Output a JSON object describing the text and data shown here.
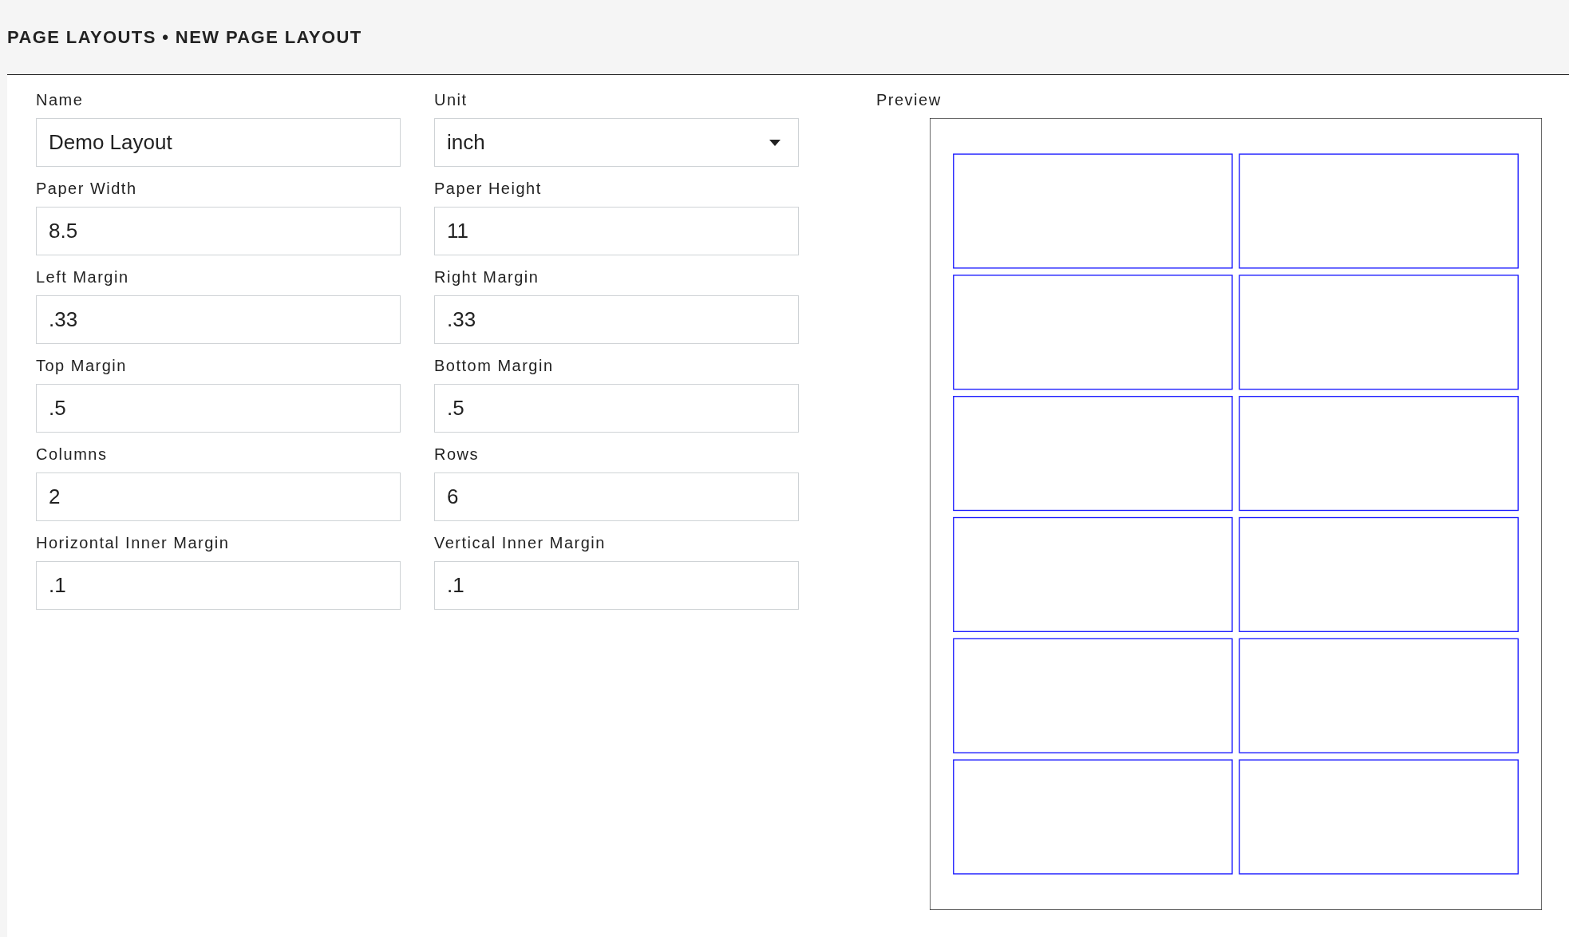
{
  "header": {
    "title": "PAGE LAYOUTS • NEW PAGE LAYOUT"
  },
  "fields": [
    {
      "label": "Name",
      "value": "Demo Layout",
      "kind": "text"
    },
    {
      "label": "Unit",
      "value": "inch",
      "kind": "select"
    },
    {
      "label": "Paper Width",
      "value": "8.5",
      "kind": "text"
    },
    {
      "label": "Paper Height",
      "value": "11",
      "kind": "text"
    },
    {
      "label": "Left Margin",
      "value": ".33",
      "kind": "text"
    },
    {
      "label": "Right Margin",
      "value": ".33",
      "kind": "text"
    },
    {
      "label": "Top Margin",
      "value": ".5",
      "kind": "text"
    },
    {
      "label": "Bottom Margin",
      "value": ".5",
      "kind": "text"
    },
    {
      "label": "Columns",
      "value": "2",
      "kind": "text"
    },
    {
      "label": "Rows",
      "value": "6",
      "kind": "text"
    },
    {
      "label": "Horizontal Inner Margin",
      "value": ".1",
      "kind": "text"
    },
    {
      "label": "Vertical Inner Margin",
      "value": ".1",
      "kind": "text"
    }
  ],
  "preview": {
    "label": "Preview"
  }
}
